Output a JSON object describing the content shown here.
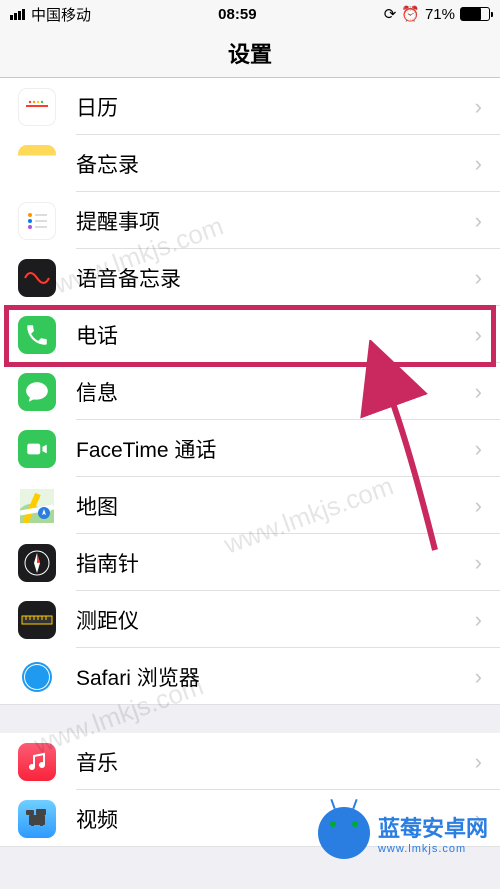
{
  "status": {
    "carrier": "中国移动",
    "time": "08:59",
    "battery_pct": "71%"
  },
  "nav": {
    "title": "设置"
  },
  "groups": [
    {
      "items": [
        {
          "id": "calendar",
          "label": "日历",
          "icon": "calendar-icon"
        },
        {
          "id": "notes",
          "label": "备忘录",
          "icon": "notes-icon"
        },
        {
          "id": "reminders",
          "label": "提醒事项",
          "icon": "reminders-icon"
        },
        {
          "id": "voice",
          "label": "语音备忘录",
          "icon": "voice-memos-icon"
        },
        {
          "id": "phone",
          "label": "电话",
          "icon": "phone-icon",
          "highlighted": true
        },
        {
          "id": "messages",
          "label": "信息",
          "icon": "messages-icon"
        },
        {
          "id": "facetime",
          "label": "FaceTime 通话",
          "icon": "facetime-icon"
        },
        {
          "id": "maps",
          "label": "地图",
          "icon": "maps-icon"
        },
        {
          "id": "compass",
          "label": "指南针",
          "icon": "compass-icon"
        },
        {
          "id": "measure",
          "label": "测距仪",
          "icon": "measure-icon"
        },
        {
          "id": "safari",
          "label": "Safari 浏览器",
          "icon": "safari-icon"
        }
      ]
    },
    {
      "items": [
        {
          "id": "music",
          "label": "音乐",
          "icon": "music-icon"
        },
        {
          "id": "video",
          "label": "视频",
          "icon": "video-icon"
        }
      ]
    }
  ],
  "watermark": {
    "text": "www.lmkjs.com",
    "brand": "蓝莓安卓网",
    "brand_sub": "www.lmkjs.com"
  },
  "highlight_color": "#c9295f"
}
